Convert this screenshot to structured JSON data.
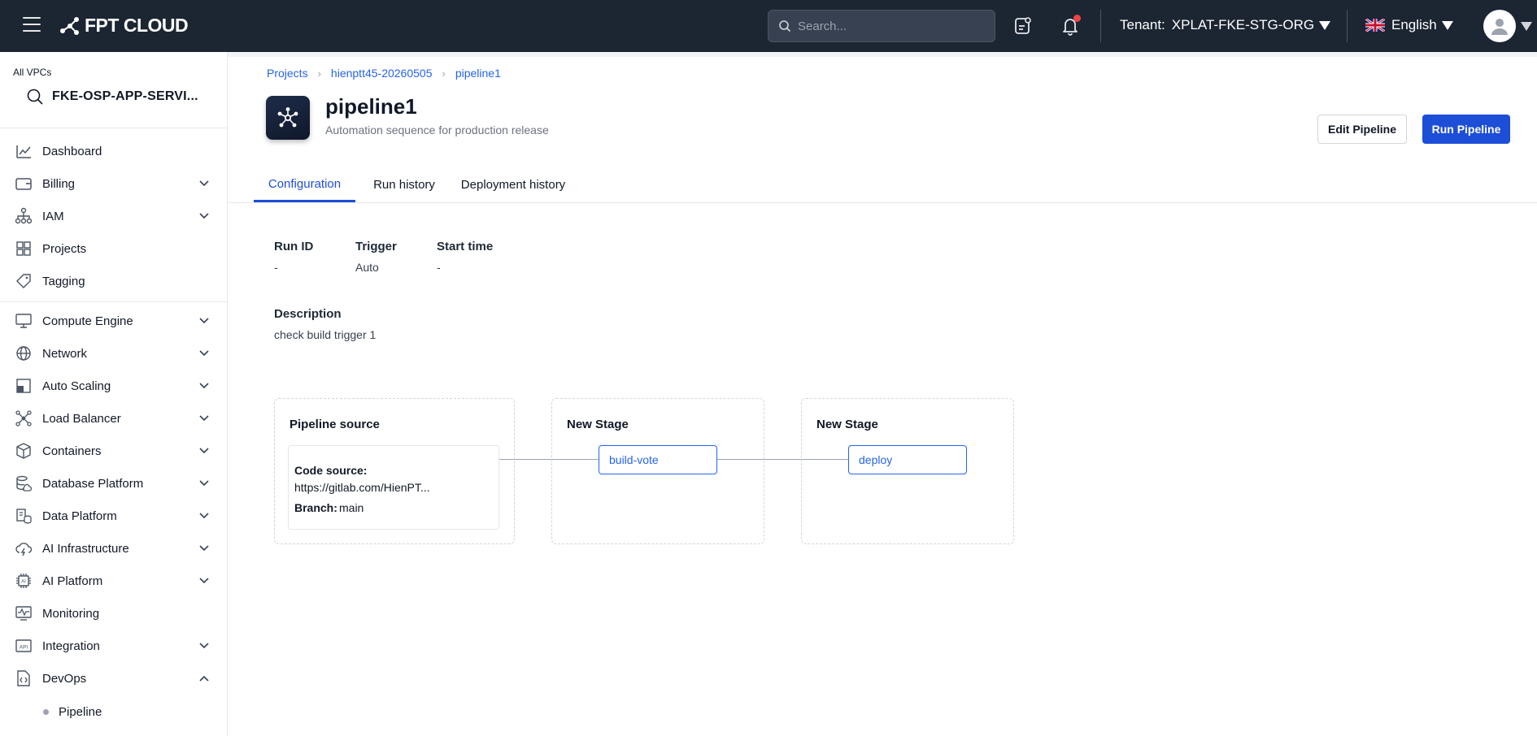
{
  "header": {
    "brand": "FPT CLOUD",
    "search_placeholder": "Search...",
    "tenant_label": "Tenant:",
    "tenant_value": "XPLAT-FKE-STG-ORG",
    "language": "English"
  },
  "sidebar": {
    "vpc_label": "All VPCs",
    "vpc_value": "FKE-OSP-APP-SERVI...",
    "items": [
      {
        "label": "Dashboard",
        "icon": "chart-icon",
        "expandable": false
      },
      {
        "label": "Billing",
        "icon": "wallet-icon",
        "expandable": true
      },
      {
        "label": "IAM",
        "icon": "hierarchy-icon",
        "expandable": true
      },
      {
        "label": "Projects",
        "icon": "grid-icon",
        "expandable": false
      },
      {
        "label": "Tagging",
        "icon": "tag-icon",
        "expandable": false
      },
      {
        "label": "Compute Engine",
        "icon": "monitor-icon",
        "expandable": true
      },
      {
        "label": "Network",
        "icon": "globe-icon",
        "expandable": true
      },
      {
        "label": "Auto Scaling",
        "icon": "scaling-icon",
        "expandable": true
      },
      {
        "label": "Load Balancer",
        "icon": "nodes-icon",
        "expandable": true
      },
      {
        "label": "Containers",
        "icon": "cube-icon",
        "expandable": true
      },
      {
        "label": "Database Platform",
        "icon": "database-icon",
        "expandable": true
      },
      {
        "label": "Data Platform",
        "icon": "data-icon",
        "expandable": true
      },
      {
        "label": "AI Infrastructure",
        "icon": "cloud-bolt-icon",
        "expandable": true
      },
      {
        "label": "AI Platform",
        "icon": "ai-chip-icon",
        "expandable": true
      },
      {
        "label": "Monitoring",
        "icon": "pulse-icon",
        "expandable": false
      },
      {
        "label": "Integration",
        "icon": "api-icon",
        "expandable": true
      },
      {
        "label": "DevOps",
        "icon": "code-file-icon",
        "expandable": true,
        "expanded": true
      }
    ],
    "sub_items": [
      {
        "label": "Pipeline"
      }
    ]
  },
  "breadcrumb": [
    "Projects",
    "hienptt45-20260505",
    "pipeline1"
  ],
  "page": {
    "title": "pipeline1",
    "subtitle": "Automation sequence for production release",
    "edit_button": "Edit Pipeline",
    "run_button": "Run Pipeline"
  },
  "tabs": [
    "Configuration",
    "Run history",
    "Deployment history"
  ],
  "info": {
    "run_id_label": "Run ID",
    "run_id_value": "-",
    "trigger_label": "Trigger",
    "trigger_value": "Auto",
    "start_time_label": "Start time",
    "start_time_value": "-",
    "description_label": "Description",
    "description_value": "check build trigger 1"
  },
  "pipeline": {
    "source_title": "Pipeline source",
    "code_source_label": "Code source:",
    "code_source_value": "https://gitlab.com/HienPT...",
    "branch_label": "Branch:",
    "branch_value": "main",
    "stages": [
      {
        "title": "New Stage",
        "job": "build-vote"
      },
      {
        "title": "New Stage",
        "job": "deploy"
      }
    ]
  },
  "colors": {
    "topbar": "#1c2532",
    "accent": "#1d4ed8",
    "link": "#2563eb",
    "notification": "#ef4444"
  }
}
